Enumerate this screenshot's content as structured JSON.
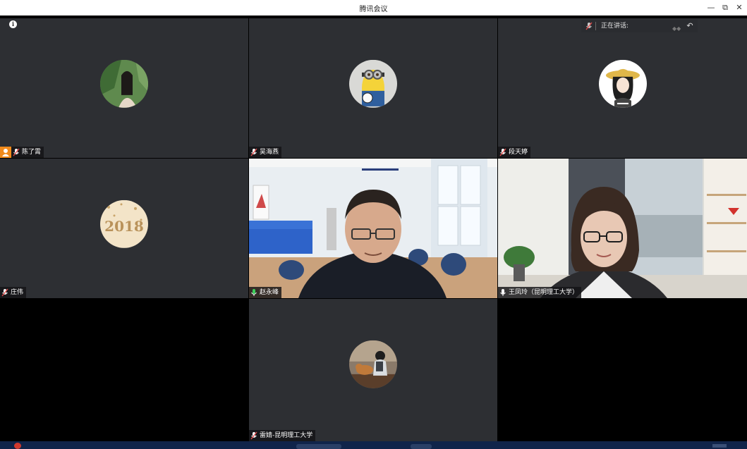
{
  "window": {
    "title": "腾讯会议",
    "minimize_icon": "minimize-icon",
    "restore_icon": "restore-icon",
    "close_icon": "close-icon",
    "minimize_glyph": "—",
    "restore_glyph": "⧉",
    "close_glyph": "✕"
  },
  "speaking": {
    "label": "正在讲话:",
    "arrow": "↶"
  },
  "info": {
    "glyph": "i"
  },
  "participants": [
    {
      "name": "陈了霄",
      "mic": "muted",
      "avatar": "portrait-woman-leaves",
      "is_host": true
    },
    {
      "name": "吴海燕",
      "mic": "muted",
      "avatar": "minion-cartoon"
    },
    {
      "name": "段天婷",
      "mic": "muted",
      "avatar": "girl-sunhat-cartoon"
    },
    {
      "name": "庄伟",
      "mic": "muted",
      "avatar": "2018-gold"
    },
    {
      "name": "赵永峰",
      "mic": "active",
      "video": true
    },
    {
      "name": "王凤玲（昆明理工大学）",
      "mic": "active",
      "video": true
    },
    {
      "name": "雷婧-昆明理工大学",
      "mic": "muted",
      "avatar": "child-with-dog"
    }
  ],
  "colors": {
    "tile_bg": "#2d2f33",
    "host_badge": "#f08a1c",
    "muted_mic": "#e04a4a",
    "active_mic": "#3ccf5a"
  }
}
